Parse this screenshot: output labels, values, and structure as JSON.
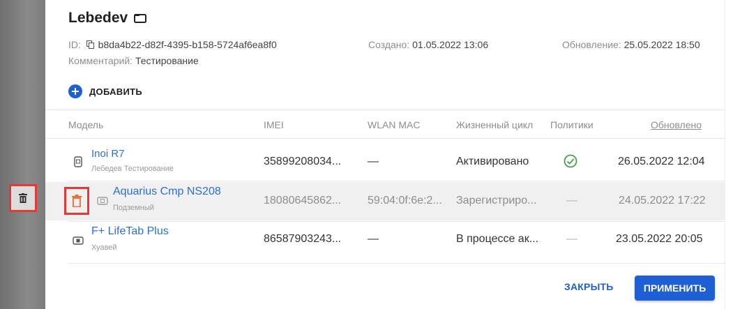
{
  "group": {
    "title": "Lebedev",
    "id_label": "ID:",
    "id_value": "b8da4b22-d82f-4395-b158-5724af6ea8f0",
    "created_label": "Создано:",
    "created_value": "01.05.2022 13:06",
    "updated_label": "Обновление:",
    "updated_value": "25.05.2022 18:50",
    "comment_label": "Комментарий:",
    "comment_value": "Тестирование"
  },
  "actions": {
    "add_label": "ДОБАВИТЬ",
    "close_label": "ЗАКРЫТЬ",
    "apply_label": "ПРИМЕНИТЬ"
  },
  "table": {
    "headers": {
      "model": "Модель",
      "imei": "IMEI",
      "wlan": "WLAN MAC",
      "lifecycle": "Жизненный цикл",
      "policies": "Политики",
      "updated": "Обновлено"
    },
    "rows": [
      {
        "name": "Inoi R7",
        "sub": "Лебедев Тестирование",
        "imei": "35899208034...",
        "wlan": "—",
        "lifecycle": "Активировано",
        "policies": "ok",
        "updated": "26.05.2022 12:04",
        "icon": "phone-icon"
      },
      {
        "name": "Aquarius Cmp NS208",
        "sub": "Подземный",
        "imei": "18080645862...",
        "wlan": "59:04:0f:6e:2...",
        "lifecycle": "Зарегистриро...",
        "policies": "—",
        "updated": "24.05.2022 17:22",
        "icon": "tablet-icon"
      },
      {
        "name": "F+ LifeTab Plus",
        "sub": "Хуавей",
        "imei": "86587903243...",
        "wlan": "—",
        "lifecycle": "В процессе ак...",
        "policies": "—",
        "updated": "23.05.2022 20:05",
        "icon": "tablet-icon"
      }
    ]
  },
  "colors": {
    "accent": "#1e5fd6",
    "link": "#2a6fdb",
    "highlight": "#e53935",
    "success": "#43a047"
  }
}
